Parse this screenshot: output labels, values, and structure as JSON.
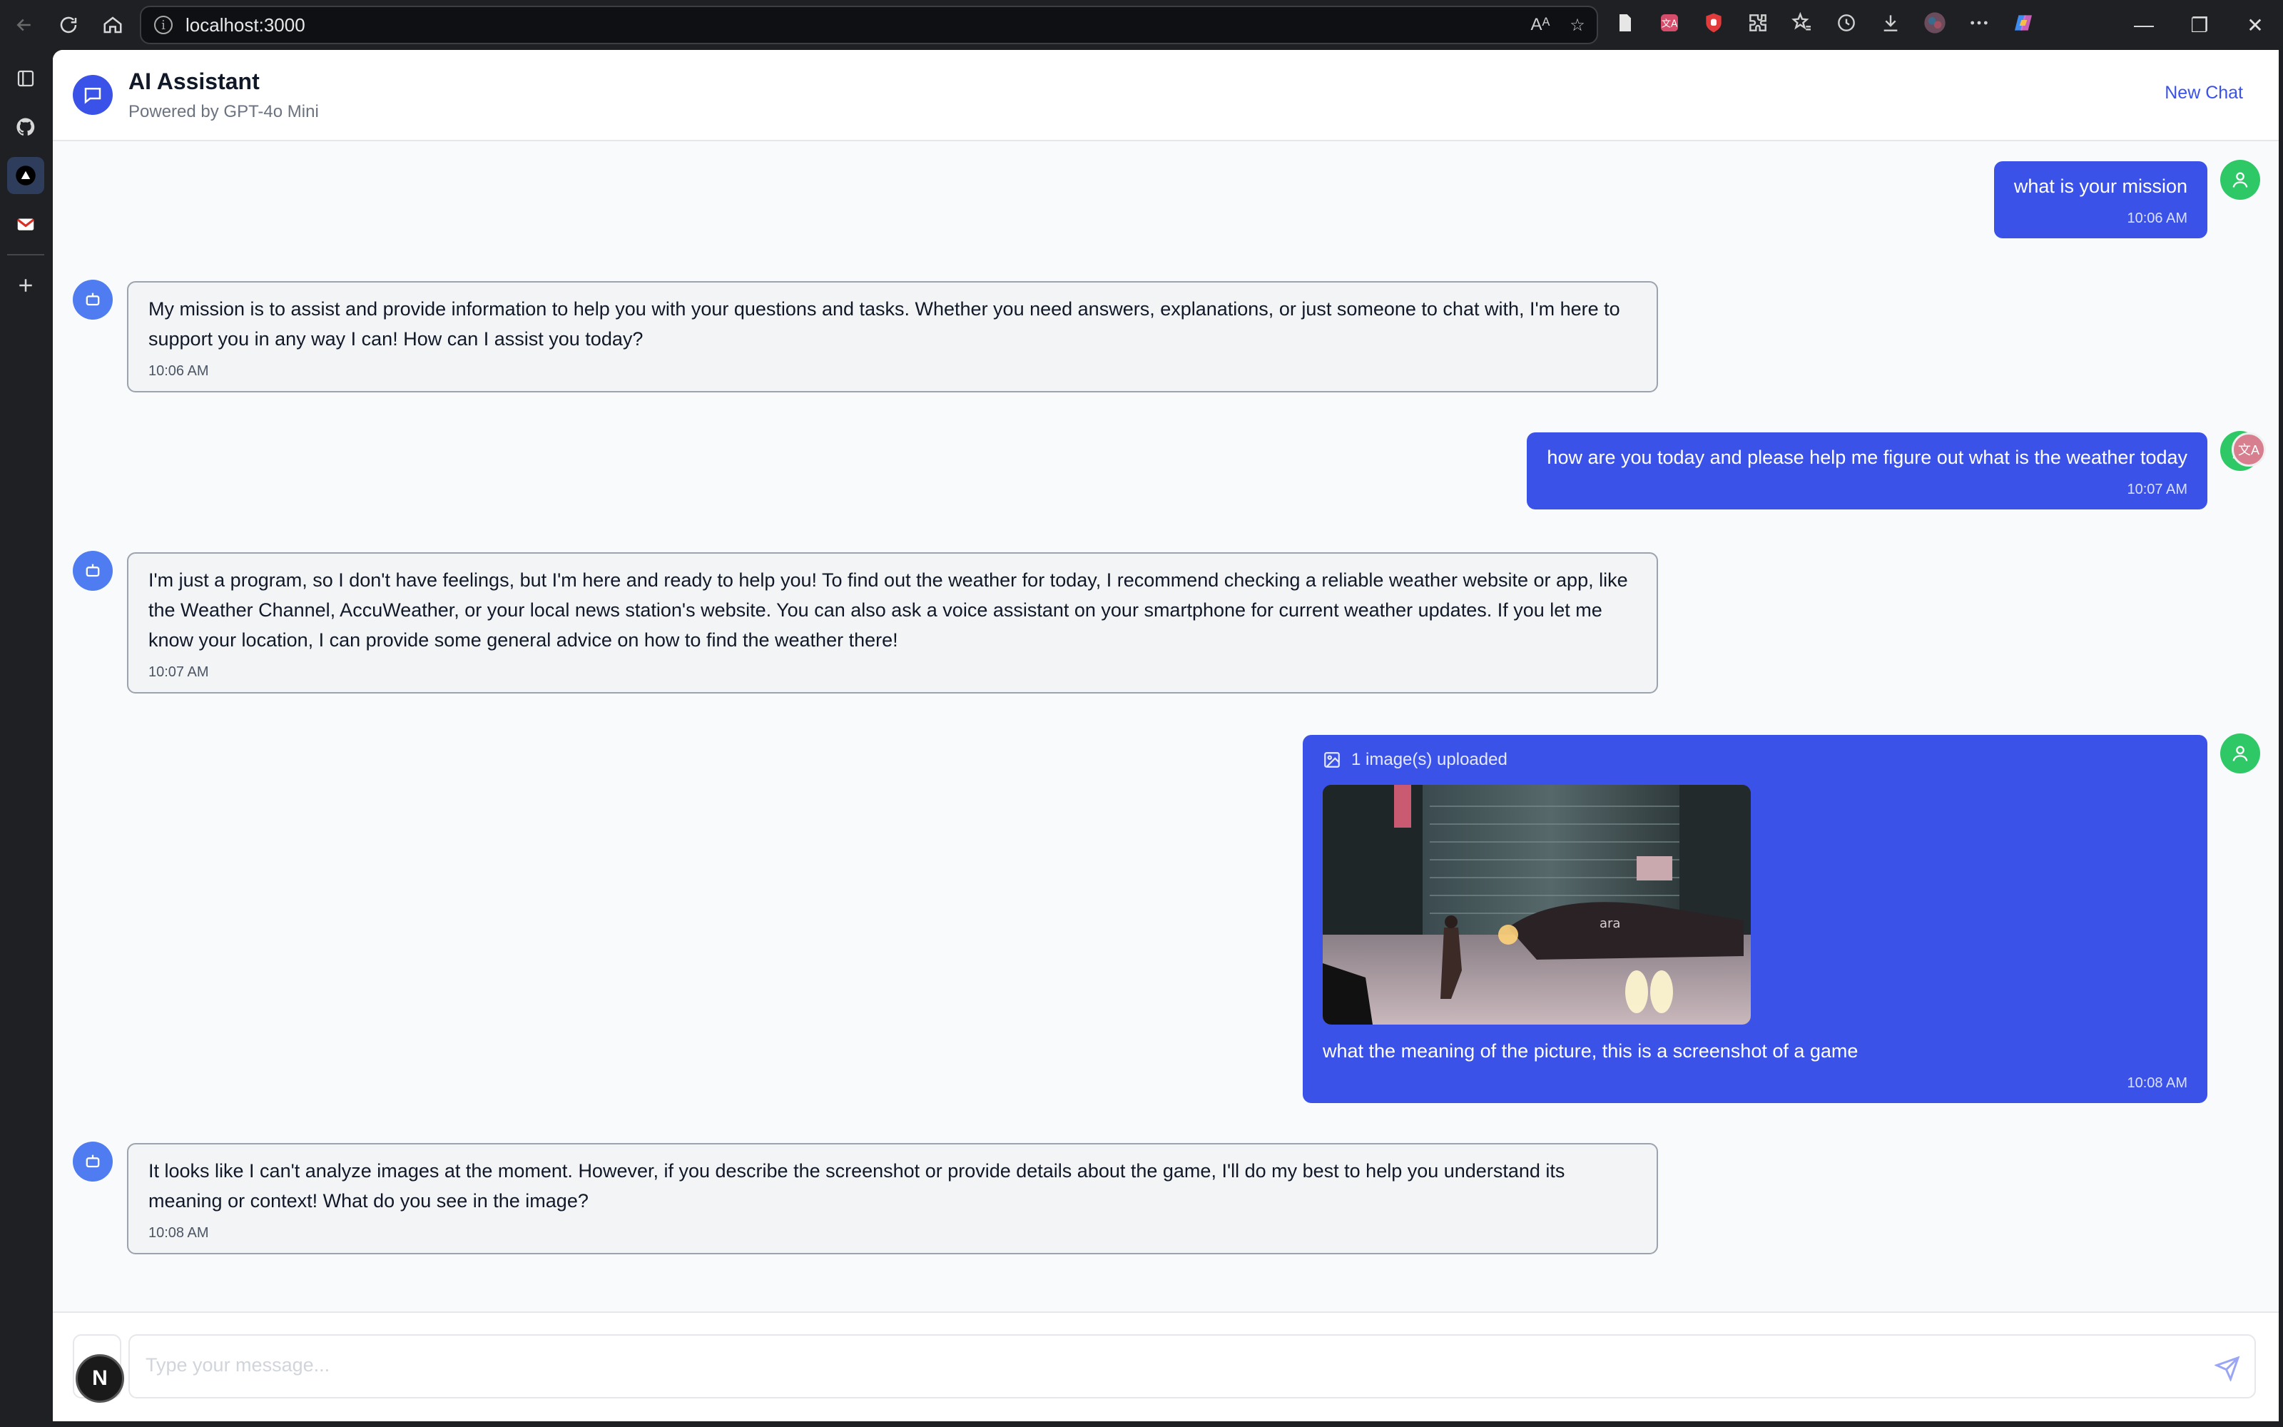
{
  "browser": {
    "url": "localhost:3000",
    "read_aloud_glyph": "Aᴬ",
    "ext_icons": [
      "page-icon",
      "translate-ext-icon",
      "shield-ext-icon",
      "puzzle-icon",
      "favorites-icon",
      "history-icon",
      "download-icon",
      "profile-avatar",
      "more-icon",
      "copilot-icon"
    ]
  },
  "sidebar_icons": [
    "tabs-icon",
    "github-icon",
    "vercel-icon",
    "gmail-icon",
    "add-icon"
  ],
  "header": {
    "title": "AI Assistant",
    "subtitle": "Powered by GPT-4o Mini",
    "new_chat": "New Chat"
  },
  "messages": [
    {
      "role": "user",
      "text": "what is your mission",
      "time": "10:06 AM"
    },
    {
      "role": "assistant",
      "text": "My mission is to assist and provide information to help you with your questions and tasks. Whether you need answers, explanations, or just someone to chat with, I'm here to support you in any way I can! How can I assist you today?",
      "time": "10:06 AM"
    },
    {
      "role": "user",
      "text": "how are you today and please help me figure out what is the weather today",
      "time": "10:07 AM"
    },
    {
      "role": "assistant",
      "text": "I'm just a program, so I don't have feelings, but I'm here and ready to help you! To find out the weather for today, I recommend checking a reliable weather website or app, like the Weather Channel, AccuWeather, or your local news station's website. You can also ask a voice assistant on your smartphone for current weather updates. If you let me know your location, I can provide some general advice on how to find the weather there!",
      "time": "10:07 AM"
    },
    {
      "role": "user",
      "upload_label": "1 image(s) uploaded",
      "text": "what the meaning of the picture, this is a screenshot of a game",
      "time": "10:08 AM"
    },
    {
      "role": "assistant",
      "text": "It looks like I can't analyze images at the moment. However, if you describe the screenshot or provide details about the game, I'll do my best to help you understand its meaning or context! What do you see in the image?",
      "time": "10:08 AM"
    }
  ],
  "composer": {
    "placeholder": "Type your message...",
    "badge": "N"
  },
  "colors": {
    "accent": "#3b52e8",
    "user_avatar": "#2ec866",
    "bot_avatar": "#4f7cf0"
  }
}
